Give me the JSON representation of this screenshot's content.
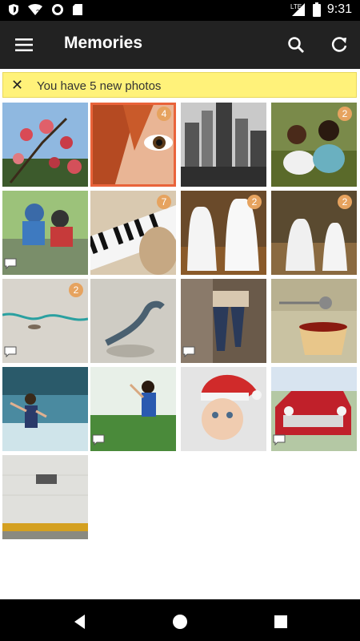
{
  "status_bar": {
    "time": "9:31",
    "network": "LTE",
    "icons": [
      "shield-icon",
      "wifi-question-icon",
      "circle-icon",
      "sd-card-icon",
      "lte-icon",
      "signal-icon",
      "battery-icon"
    ]
  },
  "app_bar": {
    "title": "Memories",
    "menu_icon": "hamburger-menu-icon",
    "search_icon": "search-icon",
    "refresh_icon": "refresh-icon"
  },
  "banner": {
    "close_icon": "close-icon",
    "message": "You have 5 new photos"
  },
  "grid": {
    "photos": [
      {
        "name": "flowers",
        "badge": "",
        "comment": false
      },
      {
        "name": "eye-closeup",
        "badge": "4",
        "comment": false
      },
      {
        "name": "city-skyline",
        "badge": "",
        "comment": false
      },
      {
        "name": "girls-sitting",
        "badge": "2",
        "comment": false
      },
      {
        "name": "kids-water",
        "badge": "",
        "comment": true
      },
      {
        "name": "piano",
        "badge": "7",
        "comment": false
      },
      {
        "name": "ghosts-forest",
        "badge": "2",
        "comment": false
      },
      {
        "name": "ghosts-park",
        "badge": "2",
        "comment": false
      },
      {
        "name": "beach-rope",
        "badge": "2",
        "comment": true
      },
      {
        "name": "sand-driftwood",
        "badge": "",
        "comment": false
      },
      {
        "name": "woman-legs",
        "badge": "",
        "comment": true
      },
      {
        "name": "tea-cup",
        "badge": "",
        "comment": false
      },
      {
        "name": "girl-ocean",
        "badge": "",
        "comment": false
      },
      {
        "name": "woman-nature",
        "badge": "",
        "comment": true
      },
      {
        "name": "baby-santa-hat",
        "badge": "",
        "comment": false
      },
      {
        "name": "red-car",
        "badge": "",
        "comment": true
      },
      {
        "name": "white-wall",
        "badge": "",
        "comment": false
      }
    ]
  },
  "nav_bar": {
    "icons": [
      "back-icon",
      "home-icon",
      "recents-icon"
    ]
  },
  "colors": {
    "app_bar": "#222222",
    "banner": "#fff27a",
    "badge": "#e6a35f",
    "selection": "#e9633a"
  }
}
